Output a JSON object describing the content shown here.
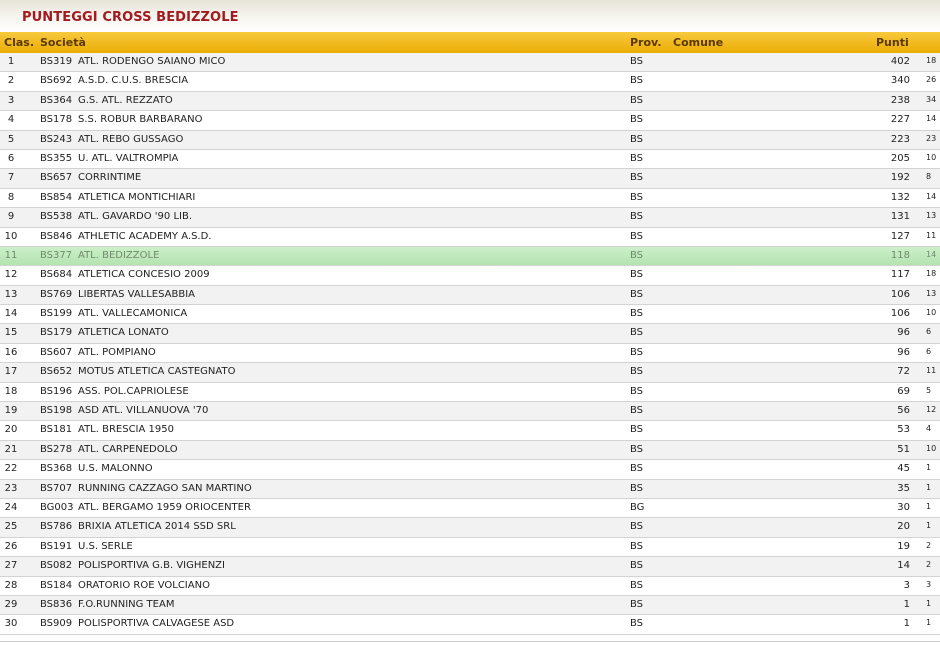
{
  "page": {
    "title": "PUNTEGGI CROSS BEDIZZOLE"
  },
  "header": {
    "rank": "Clas.",
    "team": "Società",
    "prov": "Prov.",
    "comune": "Comune",
    "points": "Punti"
  },
  "colors": {
    "title": "#a3191d",
    "header_bg": "#f0b81a",
    "highlight_bg": "#c1eabd"
  },
  "highlight_rank": "11",
  "rows": [
    {
      "rank": "1",
      "code": "BS319",
      "name": "ATL. RODENGO SAIANO MICO",
      "prov": "BS",
      "points": "402",
      "extra": "18"
    },
    {
      "rank": "2",
      "code": "BS692",
      "name": "A.S.D. C.U.S. BRESCIA",
      "prov": "BS",
      "points": "340",
      "extra": "26"
    },
    {
      "rank": "3",
      "code": "BS364",
      "name": "G.S. ATL. REZZATO",
      "prov": "BS",
      "points": "238",
      "extra": "34"
    },
    {
      "rank": "4",
      "code": "BS178",
      "name": "S.S. ROBUR BARBARANO",
      "prov": "BS",
      "points": "227",
      "extra": "14"
    },
    {
      "rank": "5",
      "code": "BS243",
      "name": "ATL. REBO GUSSAGO",
      "prov": "BS",
      "points": "223",
      "extra": "23"
    },
    {
      "rank": "6",
      "code": "BS355",
      "name": "U. ATL. VALTROMPIA",
      "prov": "BS",
      "points": "205",
      "extra": "10"
    },
    {
      "rank": "7",
      "code": "BS657",
      "name": "CORRINTIME",
      "prov": "BS",
      "points": "192",
      "extra": "8"
    },
    {
      "rank": "8",
      "code": "BS854",
      "name": "ATLETICA MONTICHIARI",
      "prov": "BS",
      "points": "132",
      "extra": "14"
    },
    {
      "rank": "9",
      "code": "BS538",
      "name": "ATL. GAVARDO '90 LIB.",
      "prov": "BS",
      "points": "131",
      "extra": "13"
    },
    {
      "rank": "10",
      "code": "BS846",
      "name": "ATHLETIC ACADEMY A.S.D.",
      "prov": "BS",
      "points": "127",
      "extra": "11"
    },
    {
      "rank": "11",
      "code": "BS377",
      "name": "ATL. BEDIZZOLE",
      "prov": "BS",
      "points": "118",
      "extra": "14"
    },
    {
      "rank": "12",
      "code": "BS684",
      "name": "ATLETICA CONCESIO 2009",
      "prov": "BS",
      "points": "117",
      "extra": "18"
    },
    {
      "rank": "13",
      "code": "BS769",
      "name": "LIBERTAS VALLESABBIA",
      "prov": "BS",
      "points": "106",
      "extra": "13"
    },
    {
      "rank": "14",
      "code": "BS199",
      "name": "ATL. VALLECAMONICA",
      "prov": "BS",
      "points": "106",
      "extra": "10"
    },
    {
      "rank": "15",
      "code": "BS179",
      "name": "ATLETICA LONATO",
      "prov": "BS",
      "points": "96",
      "extra": "6"
    },
    {
      "rank": "16",
      "code": "BS607",
      "name": "ATL. POMPIANO",
      "prov": "BS",
      "points": "96",
      "extra": "6"
    },
    {
      "rank": "17",
      "code": "BS652",
      "name": "MOTUS ATLETICA CASTEGNATO",
      "prov": "BS",
      "points": "72",
      "extra": "11"
    },
    {
      "rank": "18",
      "code": "BS196",
      "name": "ASS. POL.CAPRIOLESE",
      "prov": "BS",
      "points": "69",
      "extra": "5"
    },
    {
      "rank": "19",
      "code": "BS198",
      "name": "ASD ATL. VILLANUOVA '70",
      "prov": "BS",
      "points": "56",
      "extra": "12"
    },
    {
      "rank": "20",
      "code": "BS181",
      "name": "ATL. BRESCIA 1950",
      "prov": "BS",
      "points": "53",
      "extra": "4"
    },
    {
      "rank": "21",
      "code": "BS278",
      "name": "ATL. CARPENEDOLO",
      "prov": "BS",
      "points": "51",
      "extra": "10"
    },
    {
      "rank": "22",
      "code": "BS368",
      "name": "U.S. MALONNO",
      "prov": "BS",
      "points": "45",
      "extra": "1"
    },
    {
      "rank": "23",
      "code": "BS707",
      "name": "RUNNING CAZZAGO SAN MARTINO",
      "prov": "BS",
      "points": "35",
      "extra": "1"
    },
    {
      "rank": "24",
      "code": "BG003",
      "name": "ATL. BERGAMO 1959 ORIOCENTER",
      "prov": "BG",
      "points": "30",
      "extra": "1"
    },
    {
      "rank": "25",
      "code": "BS786",
      "name": "BRIXIA ATLETICA 2014 SSD SRL",
      "prov": "BS",
      "points": "20",
      "extra": "1"
    },
    {
      "rank": "26",
      "code": "BS191",
      "name": "U.S. SERLE",
      "prov": "BS",
      "points": "19",
      "extra": "2"
    },
    {
      "rank": "27",
      "code": "BS082",
      "name": "POLISPORTIVA G.B. VIGHENZI",
      "prov": "BS",
      "points": "14",
      "extra": "2"
    },
    {
      "rank": "28",
      "code": "BS184",
      "name": "ORATORIO ROE VOLCIANO",
      "prov": "BS",
      "points": "3",
      "extra": "3"
    },
    {
      "rank": "29",
      "code": "BS836",
      "name": "F.O.RUNNING TEAM",
      "prov": "BS",
      "points": "1",
      "extra": "1"
    },
    {
      "rank": "30",
      "code": "BS909",
      "name": "POLISPORTIVA CALVAGESE ASD",
      "prov": "BS",
      "points": "1",
      "extra": "1"
    }
  ]
}
